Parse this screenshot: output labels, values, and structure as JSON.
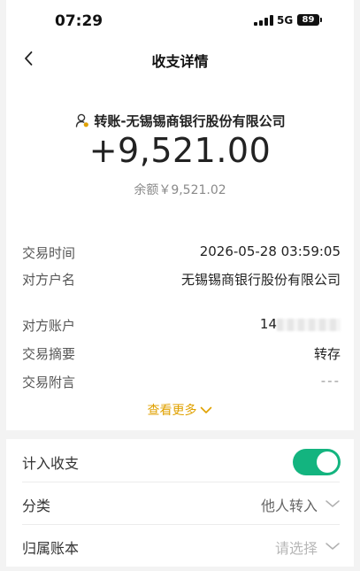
{
  "status_bar": {
    "time": "07:29",
    "network": "5G",
    "battery": "89"
  },
  "nav": {
    "title": "收支详情"
  },
  "header": {
    "counterparty": "转账-无锡锡商银行股份有限公司",
    "amount": "+9,521.00",
    "balance": "余额￥9,521.02"
  },
  "details": [
    {
      "label": "交易时间",
      "value": "2026-05-28 03:59:05"
    },
    {
      "label": "对方户名",
      "value": "无锡锡商银行股份有限公司"
    },
    {
      "label": "对方账户",
      "value": "14"
    },
    {
      "label": "交易摘要",
      "value": "转存"
    },
    {
      "label": "交易附言",
      "value": "---"
    }
  ],
  "more_label": "查看更多",
  "settings": {
    "include": {
      "label": "计入收支",
      "on": true
    },
    "category": {
      "label": "分类",
      "value": "他人转入"
    },
    "ledger": {
      "label": "归属账本",
      "placeholder": "请选择"
    }
  },
  "colors": {
    "accent": "#e0a100",
    "toggle": "#13b47f"
  }
}
